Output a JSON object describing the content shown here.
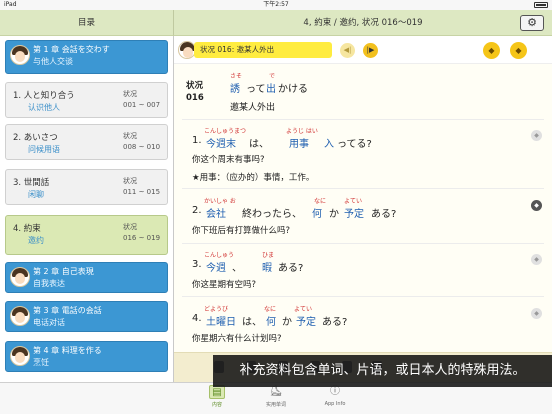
{
  "status": {
    "carrier": "iPad",
    "time": "下午2:57",
    "battery": ""
  },
  "left_nav": {
    "title": "目录"
  },
  "right_nav": {
    "title": "4, 約束 / 邀约, 状况 016～019",
    "settings_icon": "gear-icon"
  },
  "sidebar": {
    "chapters": [
      {
        "title": "第 1 章 会話を交わす",
        "subtitle": "与他人交谈"
      },
      {
        "title": "第 2 章 自己表現",
        "subtitle": "自我表达"
      },
      {
        "title": "第 3 章 電話の会話",
        "subtitle": "电话对话"
      },
      {
        "title": "第 4 章 料理を作る",
        "subtitle": "烹饪"
      }
    ],
    "lessons": [
      {
        "jp": "1.  人と知り合う",
        "cn": "认识他人",
        "label": "状况",
        "range": "001 ~ 007"
      },
      {
        "jp": "2.  あいさつ",
        "cn": "问候用语",
        "label": "状况",
        "range": "008 ~ 010"
      },
      {
        "jp": "3.  世間話",
        "cn": "闲聊",
        "label": "状况",
        "range": "011 ~ 015"
      },
      {
        "jp": "4.  約束",
        "cn": "邀约",
        "label": "状况",
        "range": "016 ~ 019"
      }
    ]
  },
  "topbar": {
    "scenario_label": "状况 016: 邀某人外出",
    "prev_icon": "skip-back-icon",
    "next_icon": "skip-forward-icon"
  },
  "scenario": {
    "label": "状况",
    "number": "016",
    "title_ruby": [
      {
        "text": "さそ"
      },
      {
        "text": "で"
      }
    ],
    "title_jp_a": "誘",
    "title_jp_b": "って",
    "title_jp_c": "出",
    "title_jp_d": "かける",
    "title_cn": "邀某人外出"
  },
  "sentences": [
    {
      "ruby": [
        "こんしゅうまつ",
        "ようじ はい"
      ],
      "jp_num": "1.",
      "jp": [
        "今週末",
        "は、",
        "用事",
        "入",
        "ってる?"
      ],
      "cn": "你这个周末有事吗?",
      "note": "★用事：（应办的）事情，工作。"
    },
    {
      "ruby": [
        "かいしゃ お",
        "なに",
        "よてい"
      ],
      "jp_num": "2.",
      "jp": [
        "会社",
        "終わったら、",
        "何",
        "か",
        "予定",
        "ある?"
      ],
      "cn": "你下班后有打算做什么吗?"
    },
    {
      "ruby": [
        "こんしゅう",
        "ひま"
      ],
      "jp_num": "3.",
      "jp": [
        "今週",
        "、",
        "暇",
        "ある?"
      ],
      "cn": "你这星期有空吗?"
    },
    {
      "ruby": [
        "どようび",
        "なに",
        "よてい"
      ],
      "jp_num": "4.",
      "jp": [
        "土曜日",
        "は、",
        "何",
        "か",
        "予定",
        "ある?"
      ],
      "cn": "你星期六有什么计划吗?"
    }
  ],
  "tabbar": {
    "tabs": [
      {
        "label": "内容",
        "icon": "book-icon"
      },
      {
        "label": "实用单词",
        "icon": "shoe-icon"
      },
      {
        "label": "App Info",
        "icon": "info-icon"
      }
    ]
  },
  "caption": "补充资料包含单词、片语，或日本人的特殊用法。"
}
